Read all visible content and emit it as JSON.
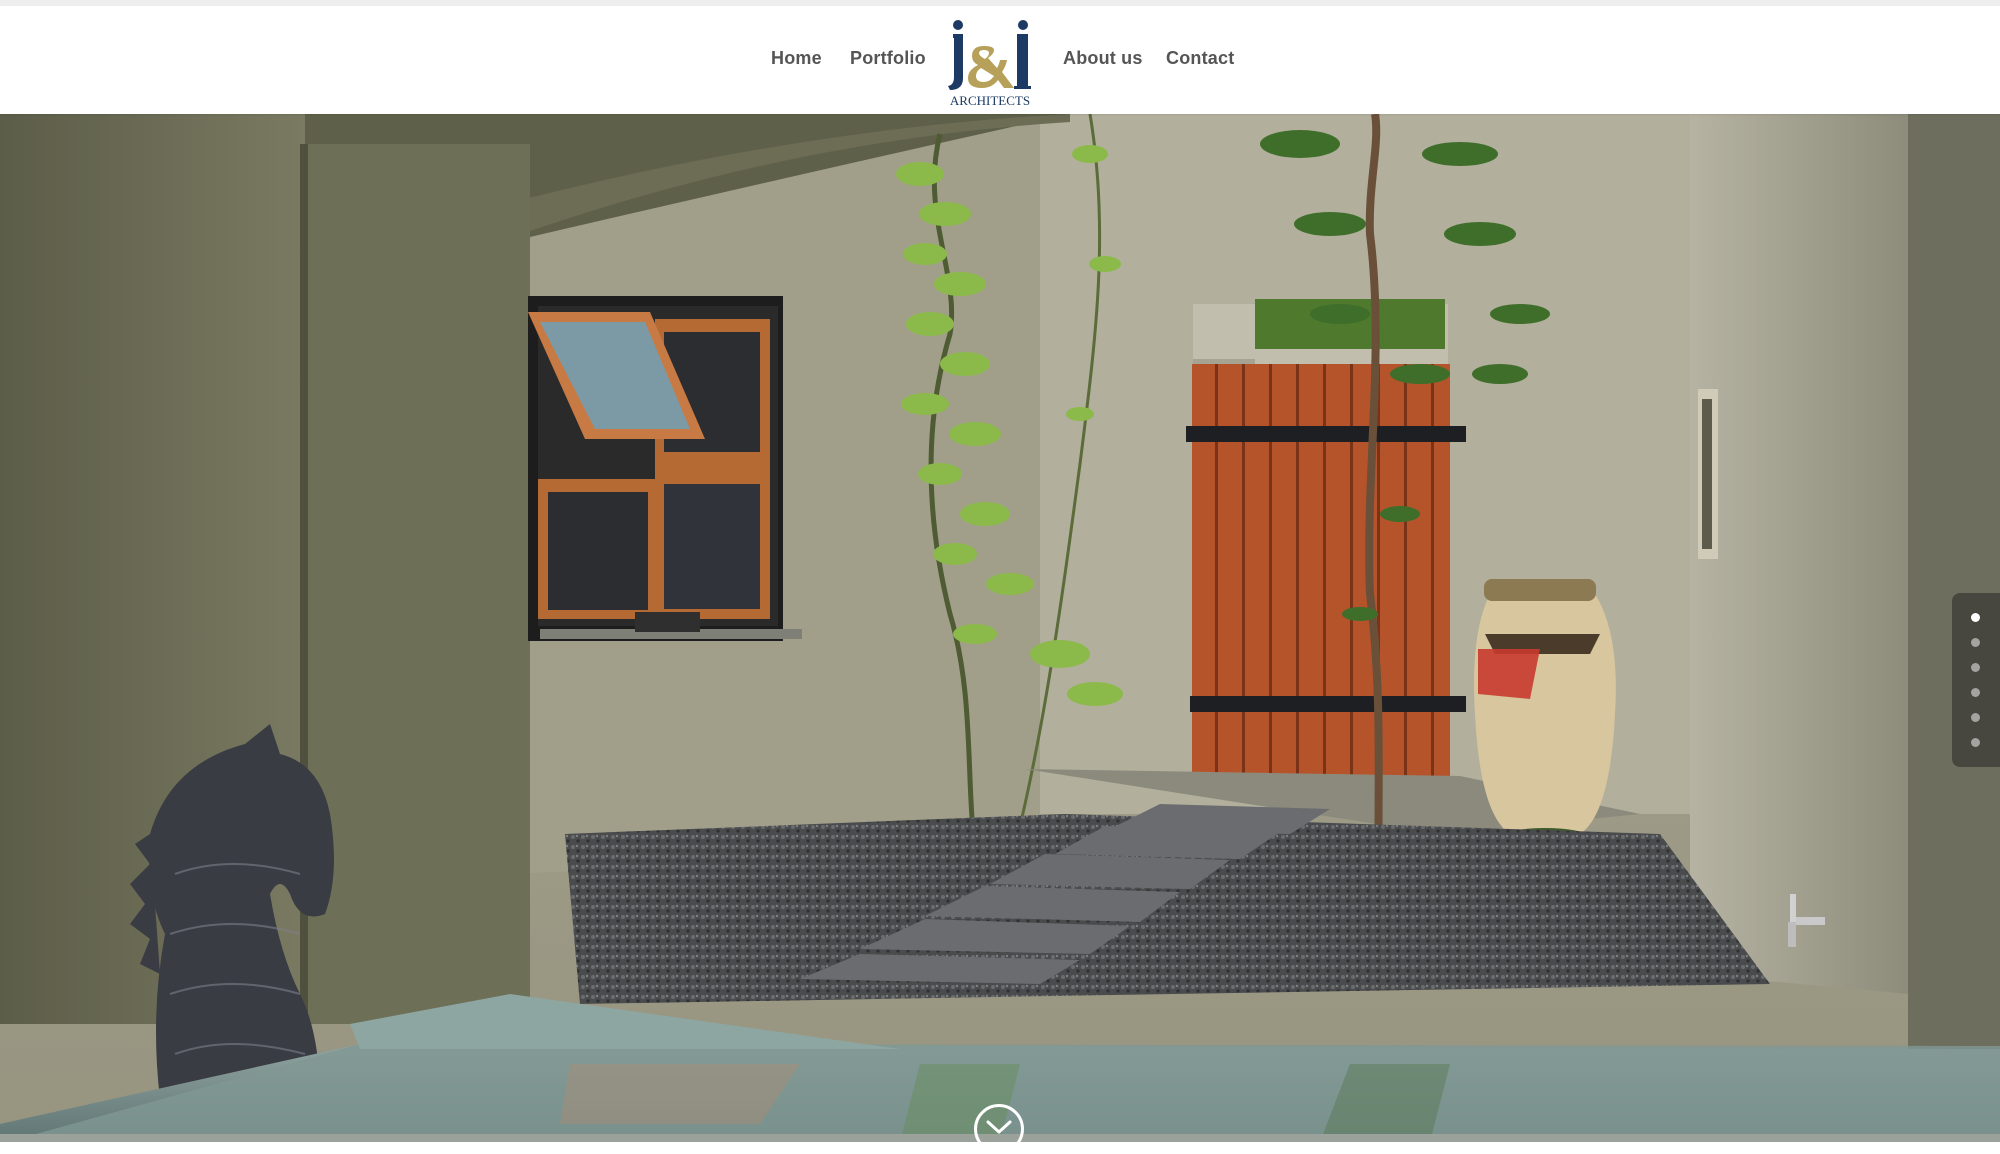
{
  "nav": {
    "home": "Home",
    "portfolio": "Portfolio",
    "about": "About us",
    "contact": "Contact"
  },
  "logo": {
    "mark": "j&i",
    "subtitle": "ARCHITECTS",
    "colors": {
      "letters": "#1c3a63",
      "ampersand": "#b6a05a"
    }
  },
  "slider": {
    "total_slides": 6,
    "active_slide": 1,
    "scroll_down_icon": "chevron-down-circle-icon"
  }
}
